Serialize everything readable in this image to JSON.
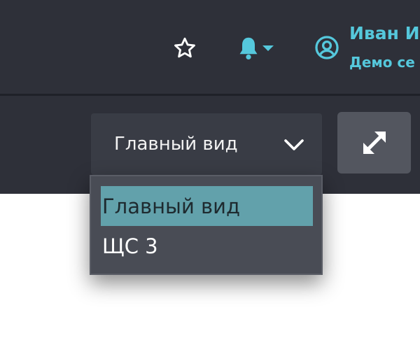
{
  "header": {
    "user": {
      "name": "Иван  И",
      "subtitle": "Демо се"
    },
    "icons": {
      "favorite": "star-icon",
      "notifications": "bell-icon",
      "notifications_menu": "caret-down-icon",
      "user": "user-circle-icon"
    },
    "accent_color": "#55c8dc"
  },
  "toolbar": {
    "view_select": {
      "selected": "Главный вид",
      "options": [
        "Главный вид",
        "ЩС 3"
      ]
    },
    "fullscreen_icon": "expand-icon"
  },
  "colors": {
    "bar_background": "#2e3039",
    "select_background": "#393c45",
    "dropdown_background": "#494c55",
    "selected_option": "#62a1ab"
  }
}
